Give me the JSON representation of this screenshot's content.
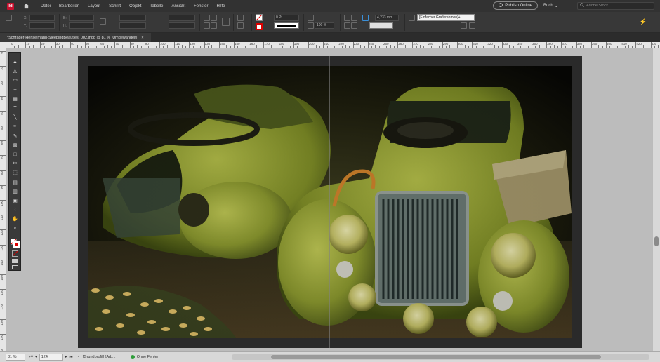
{
  "menubar": {
    "app_logo": "Id",
    "items": [
      "Datei",
      "Bearbeiten",
      "Layout",
      "Schrift",
      "Objekt",
      "Tabelle",
      "Ansicht",
      "Fenster",
      "Hilfe"
    ],
    "publish_label": "Publish Online",
    "workspace_label": "Buch",
    "search_placeholder": "Adobe Stock"
  },
  "control_panel": {
    "x_label": "X:",
    "y_label": "Y:",
    "w_label": "B:",
    "h_label": "H:",
    "stroke_weight": "0 Pt",
    "opacity": "100 %",
    "dimension_value": "4,233 mm",
    "object_style": "[Einfacher Grafikrahmen]+"
  },
  "document": {
    "tab_title": "*Schrader-Henselmann-SleepingBeauties_002.indd @ 81 % [Umgewandelt]",
    "close_glyph": "×"
  },
  "ruler": {
    "h_labels": [
      "0",
      "10",
      "20",
      "30",
      "40",
      "50",
      "60",
      "70",
      "80",
      "90",
      "100",
      "110",
      "120",
      "130",
      "140",
      "150",
      "160",
      "170",
      "180",
      "190",
      "200",
      "210",
      "220",
      "230",
      "240",
      "250",
      "260",
      "270",
      "280",
      "290",
      "300",
      "310",
      "320",
      "330",
      "340",
      "350",
      "360",
      "370",
      "380",
      "390",
      "400",
      "410",
      "420",
      "430"
    ],
    "v_labels": [
      "0",
      "10",
      "20",
      "30",
      "40",
      "50",
      "60",
      "70",
      "80",
      "90",
      "100",
      "110",
      "120",
      "130",
      "140",
      "150",
      "160",
      "170",
      "180",
      "190",
      "200",
      "210"
    ]
  },
  "toolbox": {
    "tools": [
      {
        "icon": "selection-tool-icon",
        "glyph": "▲"
      },
      {
        "icon": "direct-selection-tool-icon",
        "glyph": "△"
      },
      {
        "icon": "page-tool-icon",
        "glyph": "▭"
      },
      {
        "icon": "gap-tool-icon",
        "glyph": "↔"
      },
      {
        "icon": "content-collector-icon",
        "glyph": "▦"
      },
      {
        "icon": "type-tool-icon",
        "glyph": "T"
      },
      {
        "icon": "line-tool-icon",
        "glyph": "╲"
      },
      {
        "icon": "pen-tool-icon",
        "glyph": "✒"
      },
      {
        "icon": "pencil-tool-icon",
        "glyph": "✎"
      },
      {
        "icon": "rectangle-frame-tool-icon",
        "glyph": "⊠"
      },
      {
        "icon": "rectangle-tool-icon",
        "glyph": "□"
      },
      {
        "icon": "scissors-tool-icon",
        "glyph": "✂"
      },
      {
        "icon": "free-transform-tool-icon",
        "glyph": "⬚"
      },
      {
        "icon": "gradient-swatch-tool-icon",
        "glyph": "▤"
      },
      {
        "icon": "gradient-feather-tool-icon",
        "glyph": "▥"
      },
      {
        "icon": "note-tool-icon",
        "glyph": "▣"
      },
      {
        "icon": "eyedropper-tool-icon",
        "glyph": "⌇"
      },
      {
        "icon": "hand-tool-icon",
        "glyph": "✋"
      },
      {
        "icon": "zoom-tool-icon",
        "glyph": "⌕"
      }
    ]
  },
  "statusbar": {
    "zoom": "81 %",
    "page": "124",
    "preflight_profile": "[Grundprofil] (Arb...",
    "preflight_status": "Ohne Fehler"
  },
  "colors": {
    "menubar_bg": "#323232",
    "control_bg": "#383838",
    "pasteboard": "#bcbcbc",
    "status_ok": "#2e9d3a",
    "brand": "#c8102e"
  }
}
